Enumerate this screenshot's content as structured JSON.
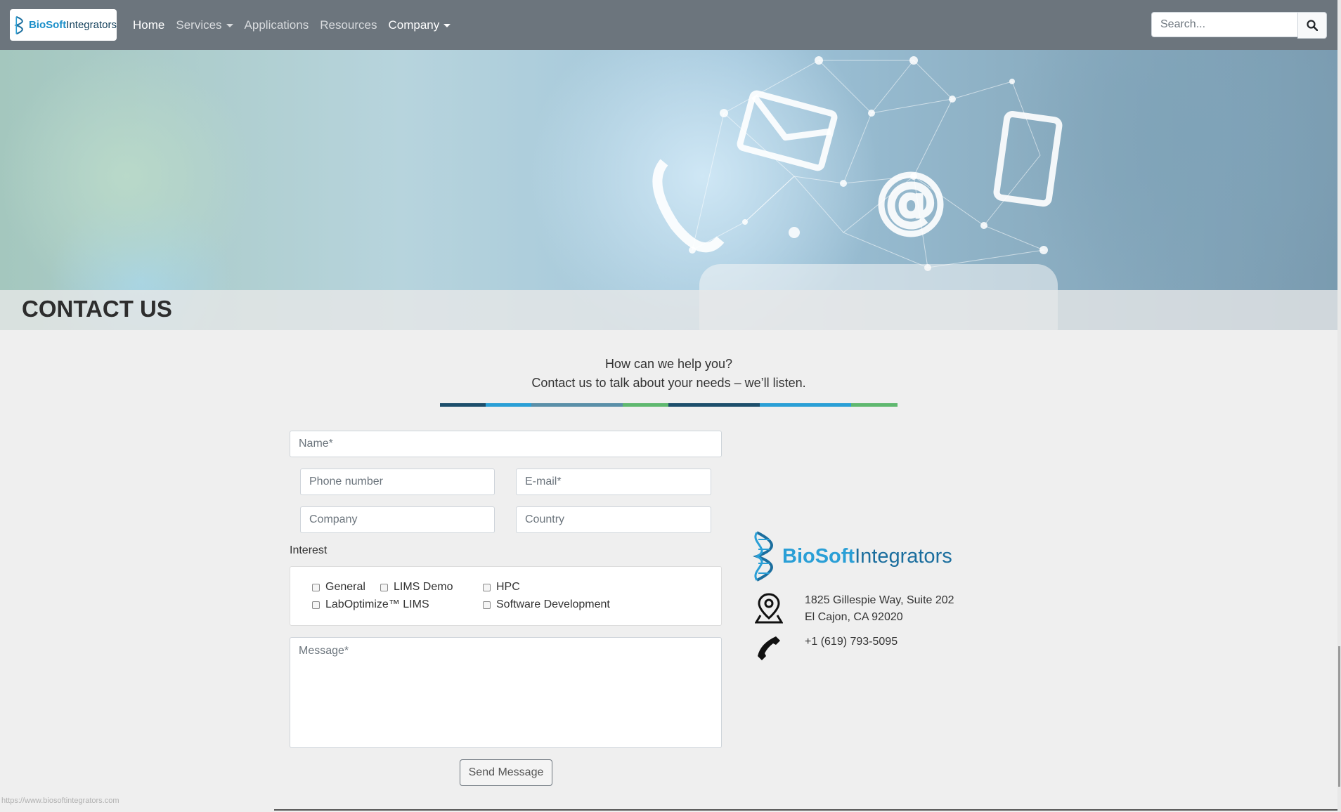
{
  "nav": {
    "brand_bold": "BioSoft",
    "brand_light": "Integrators",
    "links": [
      {
        "label": "Home",
        "active": true,
        "dropdown": false
      },
      {
        "label": "Services",
        "active": false,
        "dropdown": true
      },
      {
        "label": "Applications",
        "active": false,
        "dropdown": false
      },
      {
        "label": "Resources",
        "active": false,
        "dropdown": false
      },
      {
        "label": "Company",
        "active": true,
        "dropdown": true
      }
    ],
    "search_placeholder": "Search...",
    "search_icon": "search-icon"
  },
  "hero": {
    "title": "CONTACT US"
  },
  "intro": {
    "line1": "How can we help you?",
    "line2": "Contact us to talk about your needs – we’ll listen."
  },
  "divider_colors": [
    "#1d4e6b",
    "#2a9fd6",
    "#5fb86f",
    "#1d4e6b",
    "#2a9fd6",
    "#5fb86f",
    "#1d4e6b"
  ],
  "form": {
    "name_placeholder": "Name*",
    "phone_placeholder": "Phone number",
    "email_placeholder": "E-mail*",
    "company_placeholder": "Company",
    "country_placeholder": "Country",
    "interest_label": "Interest",
    "interests": [
      "General",
      "LIMS Demo",
      "HPC",
      "LabOptimize™ LIMS",
      "Software Development"
    ],
    "message_placeholder": "Message*",
    "send_label": "Send Message"
  },
  "contact": {
    "logo_bold": "BioSoft",
    "logo_light": "Integrators",
    "address_line1": "1825 Gillespie Way, Suite 202",
    "address_line2": "El Cajon, CA 92020",
    "phone": "+1 (619) 793-5095"
  },
  "status_url": "https://www.biosoftintegrators.com"
}
